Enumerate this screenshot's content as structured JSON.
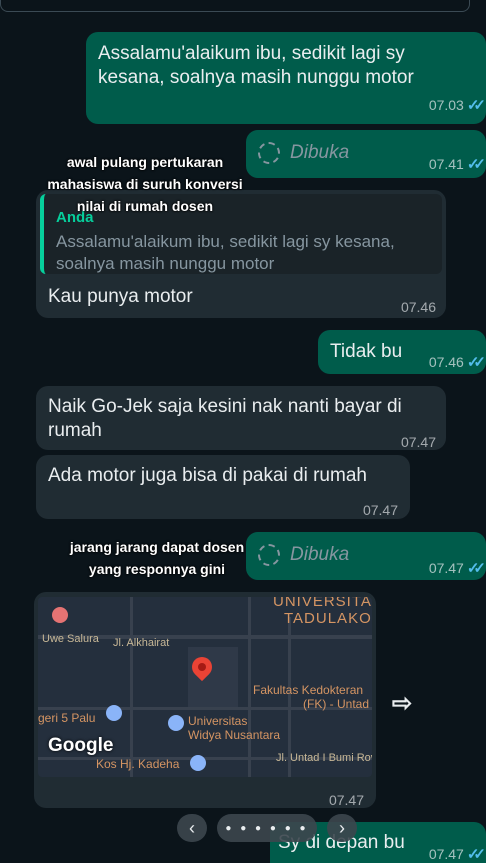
{
  "messages": {
    "m1": {
      "text": "Assalamu'alaikum ibu, sedikit lagi sy\nkesana, soalnya masih nunggu motor",
      "time": "07.03"
    },
    "m2": {
      "status": "Dibuka",
      "time": "07.41"
    },
    "m3": {
      "quote_author": "Anda",
      "quote_text": "Assalamu'alaikum ibu, sedikit lagi sy kesana,\nsoalnya masih nunggu motor",
      "text": "Kau punya motor",
      "time": "07.46"
    },
    "m4": {
      "text": "Tidak bu",
      "time": "07.46"
    },
    "m5": {
      "text": "Naik Go-Jek saja kesini nak nanti bayar di\nrumah",
      "time": "07.47"
    },
    "m6": {
      "text": "Ada motor juga bisa di pakai di rumah",
      "time": "07.47"
    },
    "m7": {
      "status": "Dibuka",
      "time": "07.47"
    },
    "m8": {
      "time": "07.47"
    },
    "m9": {
      "text": "Sy di depan bu",
      "time": "07.47"
    }
  },
  "overlays": {
    "caption1": "awal pulang pertukaran\nmahasiswa di suruh konversi\nnilai di rumah dosen",
    "caption2": "jarang jarang dapat dosen\nyang responnya gini"
  },
  "map": {
    "labels": {
      "univ1": "UNIVERSITAS",
      "univ2": "TADULAKO",
      "uwe": "Uwe Salura",
      "alkhairat": "Jl. Alkhairat",
      "fk1": "Fakultas Kedokteran",
      "fk2": "(FK) - Untad",
      "smk": "geri 5 Palu",
      "widya1": "Universitas",
      "widya2": "Widya Nusantara",
      "kos": "Kos Hj. Kadeha",
      "untad": "Jl. Untad I Bumi Roviega",
      "google": "Google"
    }
  },
  "icons": {
    "ticks": "✓✓",
    "forward": "⇨",
    "prev": "‹",
    "next": "›",
    "dots": "● ● ● ● ● ●"
  },
  "colors": {
    "background": "#0b141a",
    "outgoing": "#005c4b",
    "incoming": "#202c33",
    "read_ticks": "#53bdeb"
  }
}
